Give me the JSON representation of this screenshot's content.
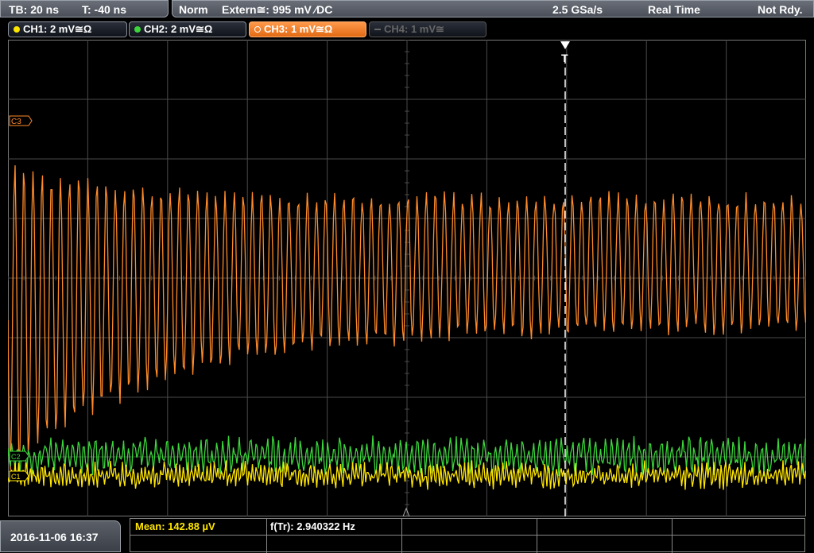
{
  "timebase": {
    "tb": "TB: 20 ns",
    "t": "T: -40 ns"
  },
  "trigger": {
    "mode": "Norm",
    "source": "Extern≅: 995 mV ⁄DC",
    "sample_rate": "2.5 GSa/s",
    "acq_mode": "Real Time",
    "status": "Not Rdy."
  },
  "channels": [
    {
      "label": "CH1: 2 mV≅Ω",
      "color": "#ffe600",
      "state": "on"
    },
    {
      "label": "CH2: 2 mV≅Ω",
      "color": "#3cd63c",
      "state": "on"
    },
    {
      "label": "CH3: 1 mV≅Ω",
      "color": "#ff8a2a",
      "state": "selected"
    },
    {
      "label": "CH4: 1 mV≅",
      "color": "#777777",
      "state": "off"
    }
  ],
  "markers": {
    "ch3": "C3",
    "ch1": "C1",
    "ch2": "C2",
    "trigger": "T"
  },
  "datetime": "2016-11-06 16:37",
  "measurements": {
    "mean": "Mean: 142.88 µV",
    "freq": "f(Tr): 2.940322 Hz"
  },
  "colors": {
    "grid": "#4a4a4a",
    "ch1": "#ffe600",
    "ch2": "#3cd63c",
    "ch3": "#ff8a2a"
  }
}
